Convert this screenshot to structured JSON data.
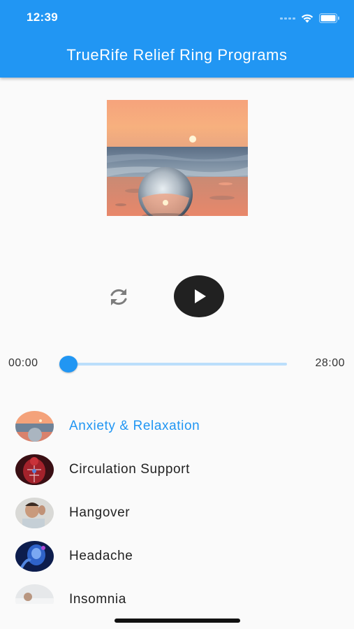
{
  "status_bar": {
    "time": "12:39",
    "icons": [
      "signal-icon",
      "wifi-icon",
      "battery-icon"
    ]
  },
  "app_bar": {
    "title": "TrueRife Relief Ring Programs",
    "color": "#2196f3"
  },
  "player": {
    "cover_image": "sunset-beach-crystal-ball",
    "controls": {
      "repeat_icon": "repeat-icon",
      "play_icon": "play-icon"
    },
    "time_start": "00:00",
    "time_end": "28:00",
    "progress": 0
  },
  "programs": [
    {
      "label": "Anxiety & Relaxation",
      "active": true,
      "thumbnail": "sunset-crystal-ball"
    },
    {
      "label": "Circulation Support",
      "active": false,
      "thumbnail": "red-circulation-body"
    },
    {
      "label": "Hangover",
      "active": false,
      "thumbnail": "man-holding-head"
    },
    {
      "label": "Headache",
      "active": false,
      "thumbnail": "blue-head-pain"
    },
    {
      "label": "Insomnia",
      "active": false,
      "thumbnail": "person-in-bed"
    }
  ],
  "colors": {
    "accent": "#2196f3",
    "play_button": "#212121",
    "track": "#bbdefb"
  }
}
